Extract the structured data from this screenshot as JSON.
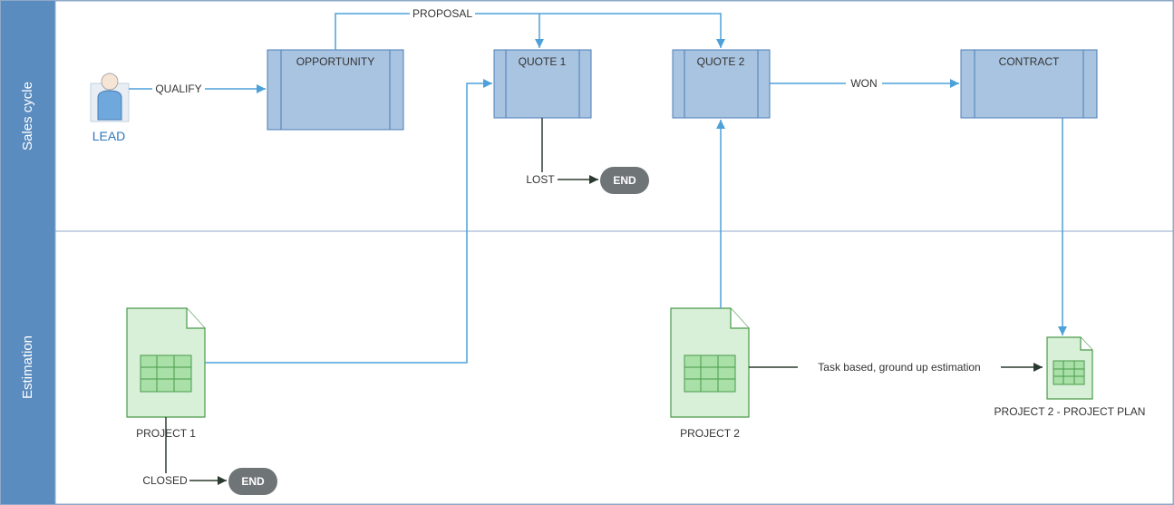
{
  "lanes": {
    "sales": "Sales cycle",
    "estimation": "Estimation"
  },
  "nodes": {
    "lead": "LEAD",
    "opportunity": "OPPORTUNITY",
    "quote1": "QUOTE 1",
    "quote2": "QUOTE 2",
    "contract": "CONTRACT",
    "end1": "END",
    "end2": "END",
    "project1": "PROJECT 1",
    "project2": "PROJECT 2",
    "project2plan": "PROJECT 2 - PROJECT PLAN"
  },
  "edges": {
    "qualify": "QUALIFY",
    "proposal": "PROPOSAL",
    "lost": "LOST",
    "won": "WON",
    "closed": "CLOSED",
    "taskbased": "Task based, ground up estimation"
  },
  "colors": {
    "lane_header": "#5b8cbf",
    "process_fill": "#a9c4e0",
    "process_border": "#4a7db8",
    "connector_blue": "#4da0d9",
    "connector_dark": "#2b3a2f",
    "pill": "#6f7476",
    "doc_fill": "#d8f0d8",
    "doc_border": "#4a9a4a"
  }
}
